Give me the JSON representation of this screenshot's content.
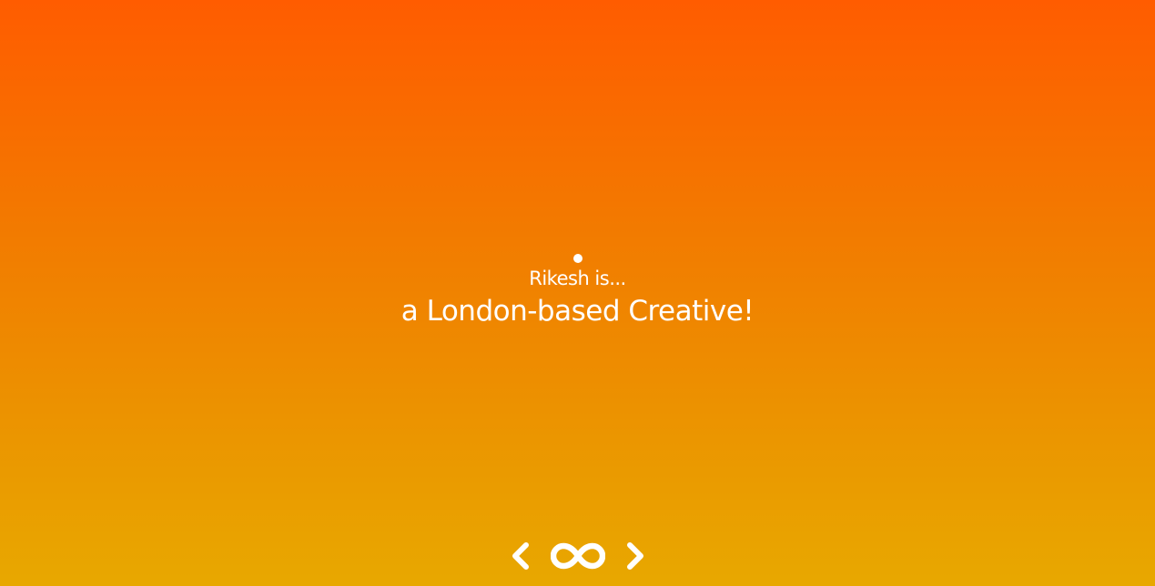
{
  "hero": {
    "intro": "Rikesh is...",
    "tagline": "a London-based Creative!"
  },
  "nav": {
    "prev_icon": "chevron-left-icon",
    "loop_icon": "infinity-icon",
    "next_icon": "chevron-right-icon"
  },
  "colors": {
    "gradient_top": "#ff5c00",
    "gradient_bottom": "#e8a800",
    "text": "#ffffff"
  }
}
